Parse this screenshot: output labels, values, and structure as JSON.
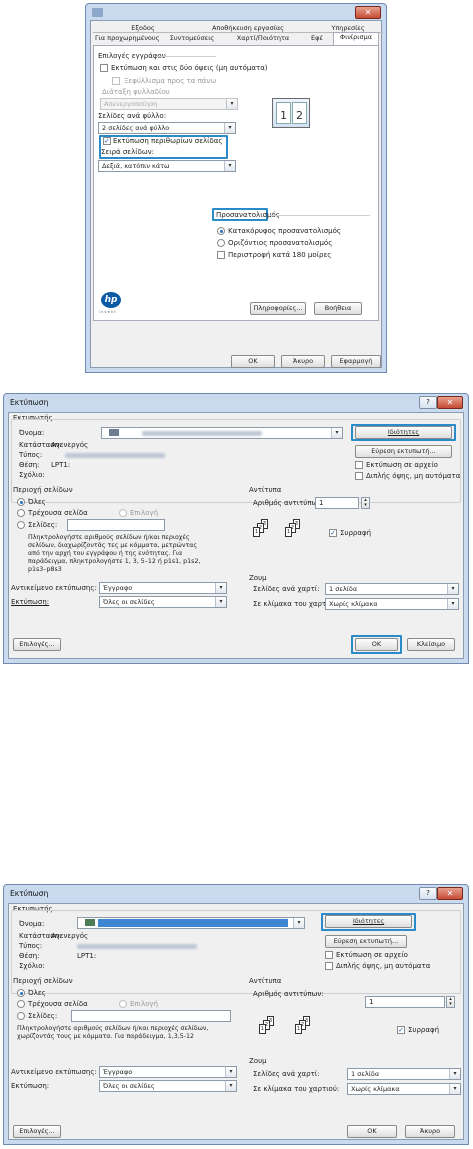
{
  "dialog1": {
    "tabs_row1": [
      "Εξοδος",
      "Αποθήκευση εργασίας",
      "Υπηρεσίες"
    ],
    "tabs_row2": [
      "Για προχωρημένους",
      "Συντομεύσεις",
      "Χαρτί/Ποιότητα",
      "Εφέ",
      "Φινίρισμα"
    ],
    "document_options_label": "Επιλογές εγγράφου",
    "print_both_sides": "Εκτύπωση και στις δύο όψεις (μη αυτόματα)",
    "flip_pages_up": "Ξεφύλλισμα προς τα πάνω",
    "booklet_layout_label": "Διάταξη φυλλαδίου",
    "booklet_layout_value": "Απενεργοποίηση",
    "pages_per_sheet_label": "Σελίδες ανά φύλλο:",
    "pages_per_sheet_value": "2 σελίδες ανά φύλλο",
    "print_page_borders": "Εκτύπωση περιθωρίων σελίδας",
    "page_order_label": "Σειρά σελίδων:",
    "page_order_value": "Δεξιά, κατόπιν κάτω",
    "preview_pages": [
      "1",
      "2"
    ],
    "orientation_label": "Προσανατολισμός",
    "portrait": "Κατακόρυφος προσανατολισμός",
    "landscape": "Οριζόντιος προσανατολισμός",
    "rotate_180": "Περιστροφή κατά 180 μοίρες",
    "info_button": "Πληροφορίες...",
    "help_button": "Βοήθεια",
    "ok_button": "OK",
    "cancel_button": "Άκυρο",
    "apply_button": "Εφαρμογή",
    "logo_text": "hp",
    "logo_subtext": "i n v e n t"
  },
  "dialog2": {
    "title": "Εκτύπωση",
    "printer_group": "Εκτυπωτής",
    "name_label": "Όνομα:",
    "status_label": "Κατάσταση:",
    "status_value": "Ανενεργός",
    "type_label": "Τύπος:",
    "where_label": "Θέση:",
    "where_value": "LPT1:",
    "comment_label": "Σχόλιο:",
    "properties_button": "Ιδιότητες",
    "find_printer_button": "Εύρεση εκτυπωτή...",
    "print_to_file": "Εκτύπωση σε αρχείο",
    "manual_duplex": "Διπλής όψης, μη αυτόματα",
    "page_range_group": "Περιοχή σελίδων",
    "all": "Όλες",
    "current_page": "Τρέχουσα σελίδα",
    "selection": "Επιλογή",
    "pages": "Σελίδες:",
    "pages_hint": "Πληκτρολογήστε αριθμούς σελίδων ή/και περιοχές σελίδων, διαχωρίζοντάς τες με κόμματα, μετρώντας από την αρχή του εγγράφου ή της ενότητας. Για παράδειγμα, πληκτρολογήστε 1, 3, 5–12 ή p1s1, p1s2, p1s3–p8s3",
    "copies_group": "Αντίτυπα",
    "copies_label": "Αριθμός αντιτύπων:",
    "copies_value": "1",
    "collate": "Συρραφή",
    "print_what_label": "Αντικείμενο εκτύπωσης:",
    "print_what_value": "Έγγραφο",
    "print_label": "Εκτύπωση:",
    "print_value": "Όλες οι σελίδες",
    "zoom_group": "Ζουμ",
    "pages_per_sheet_label": "Σελίδες ανά χαρτί:",
    "pages_per_sheet_value": "1 σελίδα",
    "scale_label": "Σε κλίμακα του χαρτιού:",
    "scale_value": "Χωρίς κλίμακα",
    "options_button": "Επιλογές...",
    "ok_button": "OK",
    "close_button": "Κλείσιμο"
  },
  "dialog3": {
    "title": "Εκτύπωση",
    "printer_group": "Εκτυπωτής",
    "name_label": "Όνομα:",
    "status_label": "Κατάσταση:",
    "status_value": "Ανενεργός",
    "type_label": "Τύπος:",
    "where_label": "Θέση:",
    "where_value": "LPT1:",
    "comment_label": "Σχόλιο:",
    "properties_button": "Ιδιότητες",
    "find_printer_button": "Εύρεση εκτυπωτή...",
    "print_to_file": "Εκτύπωση σε αρχείο",
    "manual_duplex": "Διπλής όψης, μη αυτόματα",
    "page_range_group": "Περιοχή σελίδων",
    "all": "Όλες",
    "current_page": "Τρέχουσα σελίδα",
    "selection": "Επιλογή",
    "pages": "Σελίδες:",
    "pages_hint": "Πληκτρολογήστε αριθμούς σελίδων ή/και περιοχές σελίδων, χωρίζοντάς τους με κόμματα. Για παράδειγμα, 1,3,5-12",
    "copies_group": "Αντίτυπα",
    "copies_label": "Αριθμός αντιτύπων:",
    "copies_value": "1",
    "collate": "Συρραφή",
    "print_what_label": "Αντικείμενο εκτύπωσης:",
    "print_what_value": "Έγγραφο",
    "print_label": "Εκτύπωση:",
    "print_value": "Όλες οι σελίδες",
    "zoom_group": "Ζουμ",
    "pages_per_sheet_label": "Σελίδες ανά χαρτί:",
    "pages_per_sheet_value": "1 σελίδα",
    "scale_label": "Σε κλίμακα του χαρτιού:",
    "scale_value": "Χωρίς κλίμακα",
    "options_button": "Επιλογές...",
    "ok_button": "OK",
    "cancel_button": "Άκυρο"
  }
}
